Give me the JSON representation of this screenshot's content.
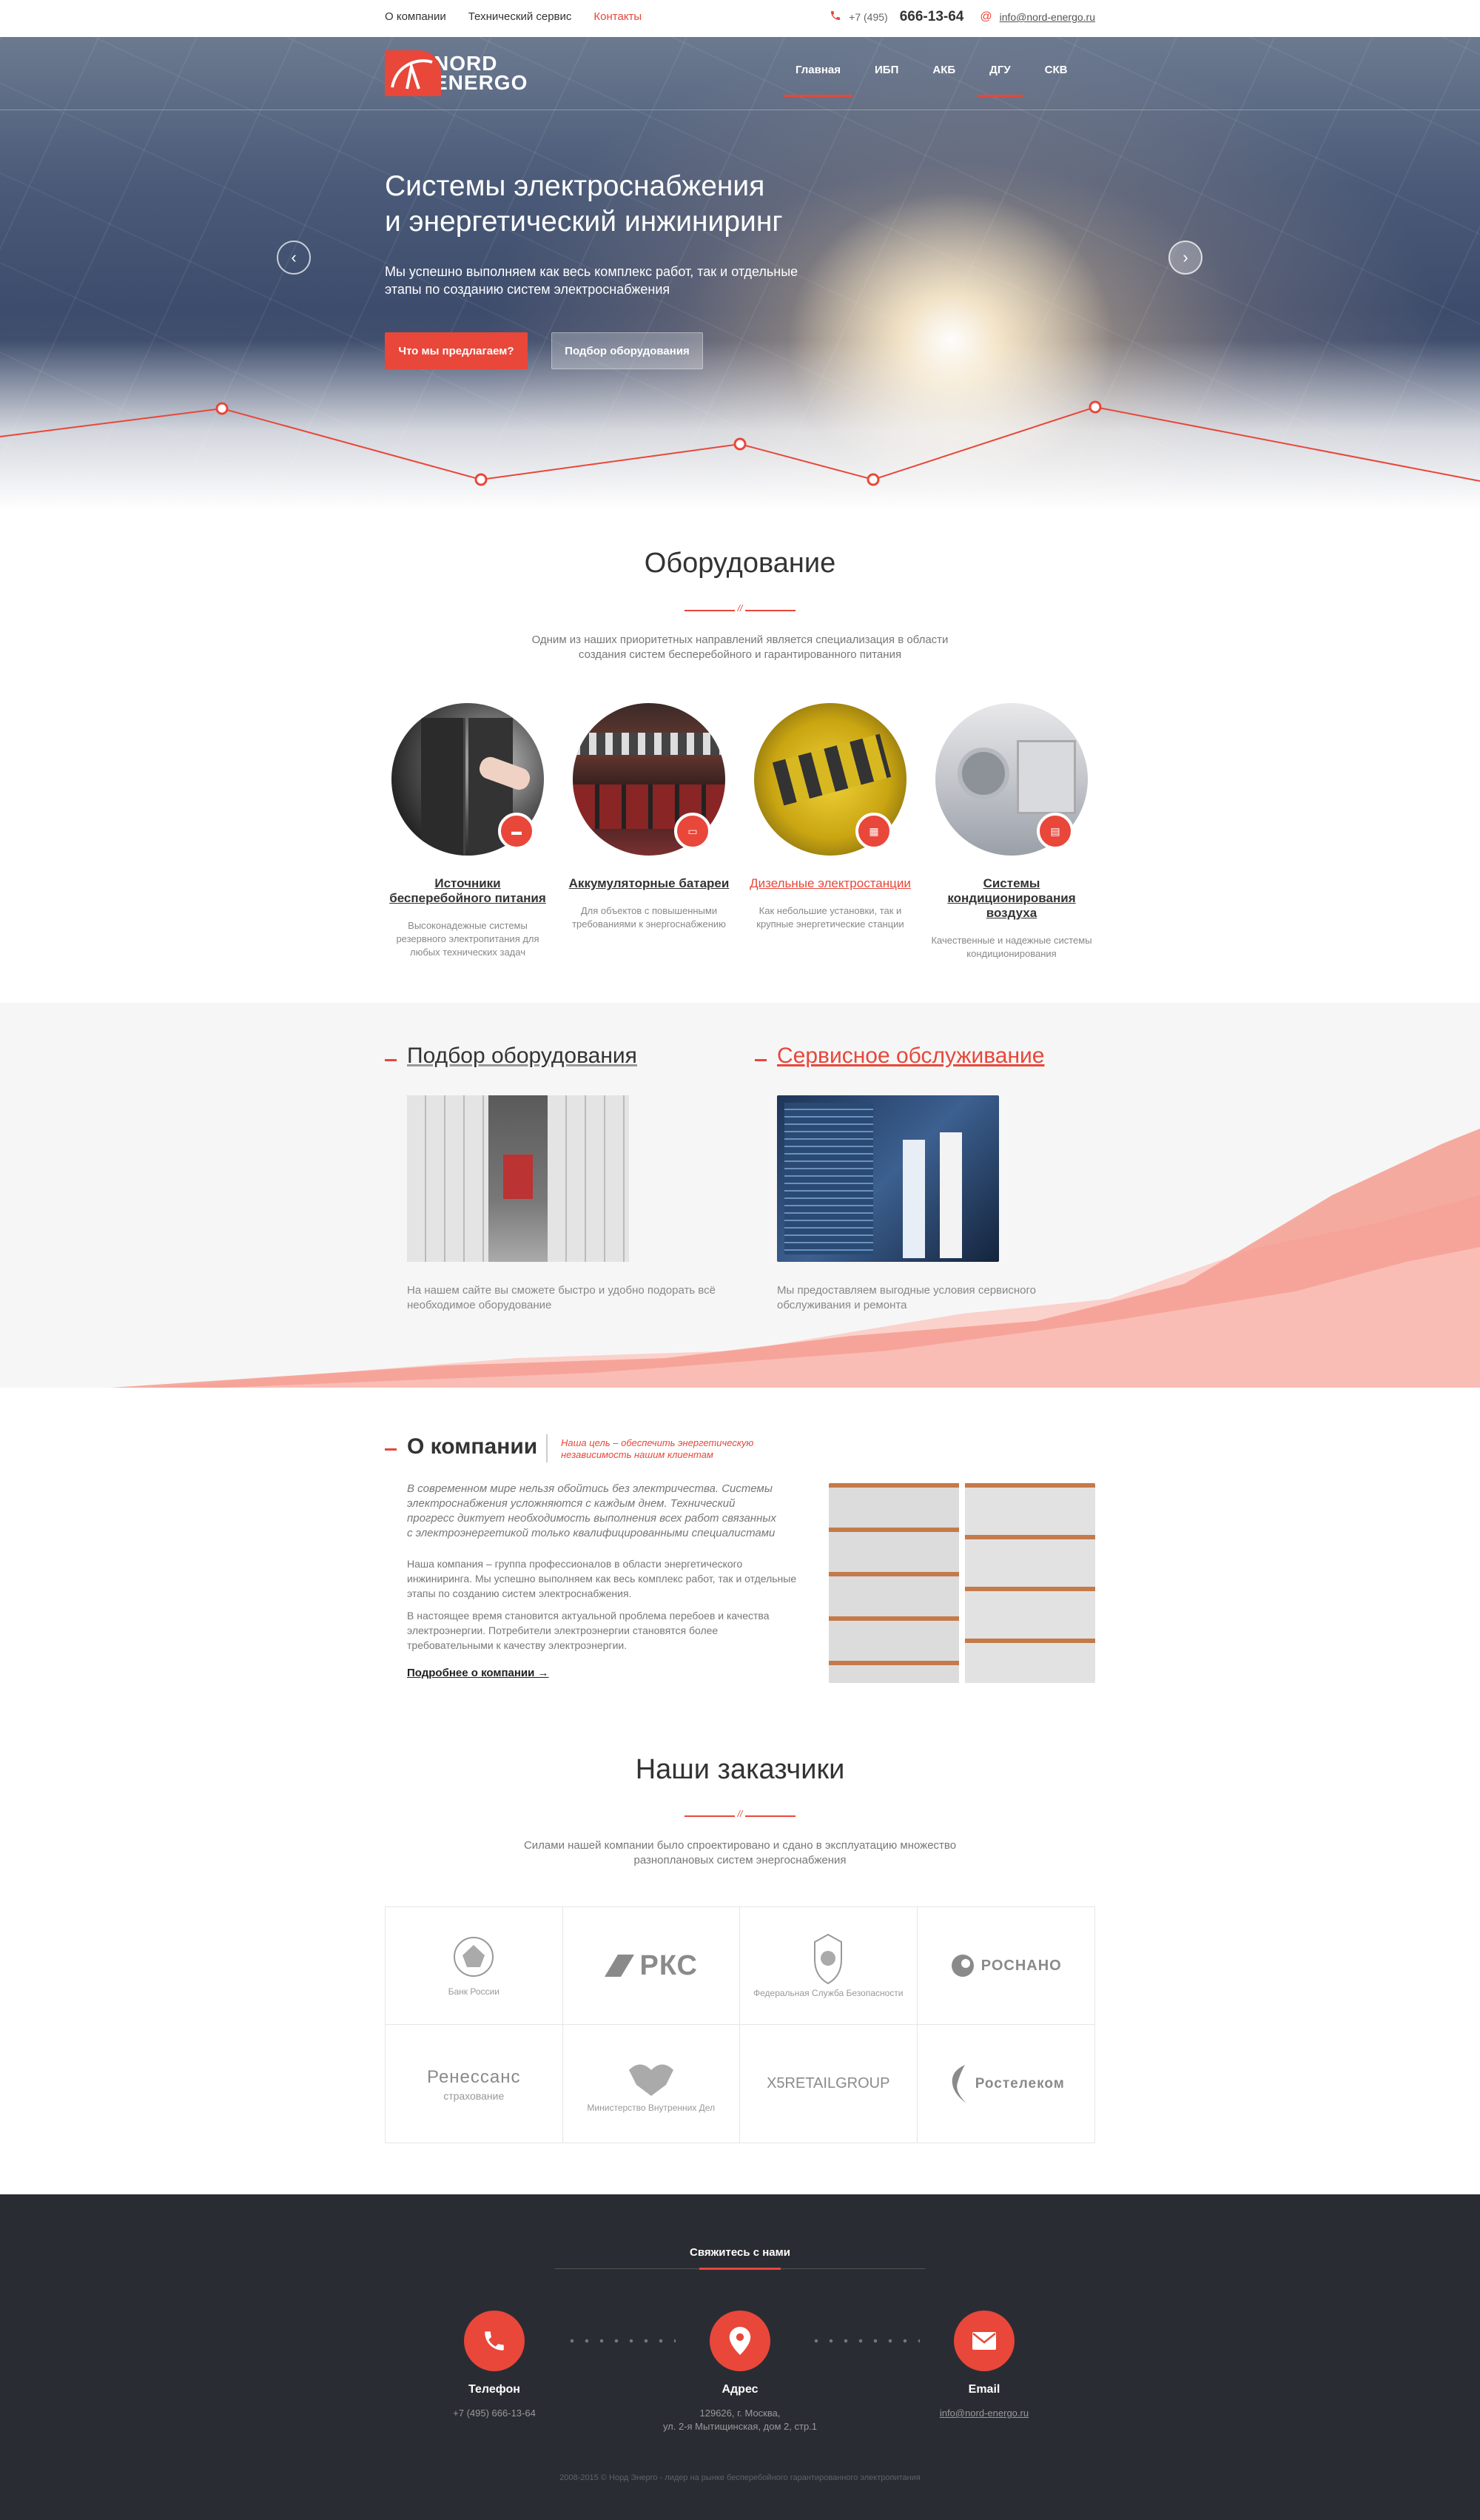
{
  "topbar": {
    "nav": [
      "О компании",
      "Технический сервис",
      "Контакты"
    ],
    "phone_prefix": "+7 (495)",
    "phone_number": "666-13-64",
    "email": "info@nord-energo.ru"
  },
  "logo": {
    "line1": "NORD",
    "line2": "ENERGO"
  },
  "mainnav": [
    "Главная",
    "ИБП",
    "АКБ",
    "ДГУ",
    "СКВ"
  ],
  "hero": {
    "title_line1": "Системы электроснабжения",
    "title_line2": "и энергетический инжиниринг",
    "subtitle": "Мы успешно выполняем как весь комплекс работ, так и отдельные этапы по созданию систем электроснабжения",
    "button_primary": "Что мы предлагаем?",
    "button_secondary": "Подбор оборудования",
    "prev_glyph": "‹",
    "next_glyph": "›"
  },
  "equipment": {
    "title": "Оборудование",
    "description": "Одним из наших приоритетных направлений является специализация в области создания систем бесперебойного и гарантированного питания",
    "items": [
      {
        "name": "Источники бесперебойного питания",
        "desc": "Высоконадежные системы резервного электропитания для любых технических задач",
        "icon": "ups-icon"
      },
      {
        "name": "Аккумуляторные батареи",
        "desc": "Для объектов с повышенными требованиями к энергоснабжению",
        "icon": "battery-icon"
      },
      {
        "name": "Дизельные электростанции",
        "desc": "Как небольшие установки, так и крупные энергетические станции",
        "icon": "generator-icon"
      },
      {
        "name": "Системы кондиционирования воздуха",
        "desc": "Качественные и надежные системы кондиционирования",
        "icon": "ac-icon"
      }
    ]
  },
  "band": {
    "left_title": "Подбор оборудования",
    "left_desc": "На нашем сайте вы сможете быстро и удобно подорать всё необходимое оборудование",
    "right_title": "Сервисное обслуживание",
    "right_desc": "Мы предоставляем выгодные условия сервисного обслуживания и ремонта"
  },
  "about": {
    "title": "О компании",
    "slogan": "Наша цель – обеспечить энергетическую независимость нашим клиентам",
    "lead": "В современном мире нельзя обойтись без электричества. Системы электроснабжения усложняются с каждым днем. Технический прогресс диктует необходимость выполнения всех работ связанных с электроэнергетикой только квалифицированными специалистами",
    "p1": "Наша компания – группа профессионалов в области энергетического инжиниринга. Мы успешно выполняем как весь комплекс работ, так и отдельные этапы по созданию систем электроснабжения.",
    "p2": "В настоящее время становится актуальной проблема перебоев и качества электроэнергии. Потребители электроэнергии становятся более требовательными к качеству электроэнергии.",
    "more_link": "Подробнее о компании →"
  },
  "clients": {
    "title": "Наши заказчики",
    "description": "Силами нашей компании было спроектировано и сдано в эксплуатацию множество разноплановых систем энергоснабжения",
    "logos": [
      {
        "main": "",
        "sub": "Банк России"
      },
      {
        "main": "РКС",
        "sub": ""
      },
      {
        "main": "",
        "sub": "Федеральная Служба Безопасности"
      },
      {
        "main": "РОСНАНО",
        "sub": ""
      },
      {
        "main": "Ренессанс",
        "sub": "страхование"
      },
      {
        "main": "",
        "sub": "Министерство Внутренних Дел"
      },
      {
        "main": "X5RETAILGROUP",
        "sub": ""
      },
      {
        "main": "Ростелеком",
        "sub": ""
      }
    ]
  },
  "footer": {
    "title": "Свяжитесь с нами",
    "phone_label": "Телефон",
    "phone_value": "+7 (495) 666-13-64",
    "address_label": "Адрес",
    "address_line1": "129626, г. Москва,",
    "address_line2": "ул. 2-я Мытищинская, дом 2, стр.1",
    "email_label": "Email",
    "email_value": "info@nord-energo.ru",
    "copyright": "2008-2015 © Норд Энерго - лидер на рынке бесперебойного гарантированного электропитания"
  },
  "colors": {
    "accent": "#e8473a",
    "footer_bg": "#2a2c33",
    "band_bg": "#f6f6f6"
  }
}
